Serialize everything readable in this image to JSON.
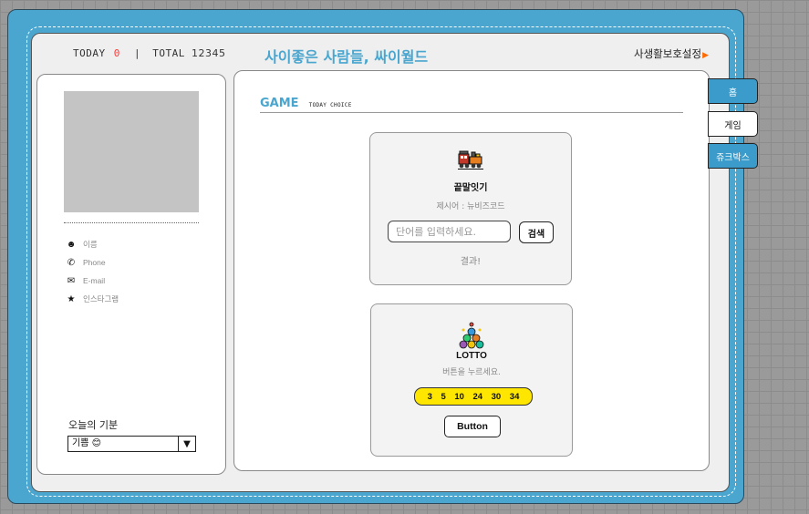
{
  "header": {
    "today_label": "TODAY",
    "today_count": "0",
    "separator": "|",
    "total_label": "TOTAL",
    "total_count": "12345",
    "site_title": "사이좋은 사람들, 싸이월드",
    "privacy_label": "사생활보호설정"
  },
  "profile": {
    "items": [
      {
        "icon": "smiley-icon",
        "label": "이름"
      },
      {
        "icon": "phone-icon",
        "label": "Phone"
      },
      {
        "icon": "envelope-icon",
        "label": "E-mail"
      },
      {
        "icon": "star-icon",
        "label": "인스타그램"
      }
    ],
    "mood_label": "오늘의 기분",
    "mood_value": "기쁨 😊"
  },
  "main": {
    "section_title": "GAME",
    "section_subtitle": "TODAY CHOICE",
    "wordchain": {
      "icon": "train-icon",
      "title": "끝말잇기",
      "suggestion": "제시어 : 뉴비즈코드",
      "input_placeholder": "단어를 입력하세요.",
      "search_label": "검색",
      "result_label": "결과!"
    },
    "lotto": {
      "icon": "lotto-balls-icon",
      "title": "LOTTO",
      "instruction": "버튼을 누르세요.",
      "numbers": [
        "3",
        "5",
        "10",
        "24",
        "30",
        "34"
      ],
      "button_label": "Button"
    }
  },
  "nav": {
    "tabs": [
      {
        "label": "홈",
        "active": false
      },
      {
        "label": "게임",
        "active": true
      },
      {
        "label": "쥬크박스",
        "active": false
      }
    ]
  },
  "colors": {
    "frame": "#4aa6cf",
    "accent": "#4aa6cf",
    "lotto_bar": "#ffe600",
    "today_count": "#ff3b3b"
  }
}
